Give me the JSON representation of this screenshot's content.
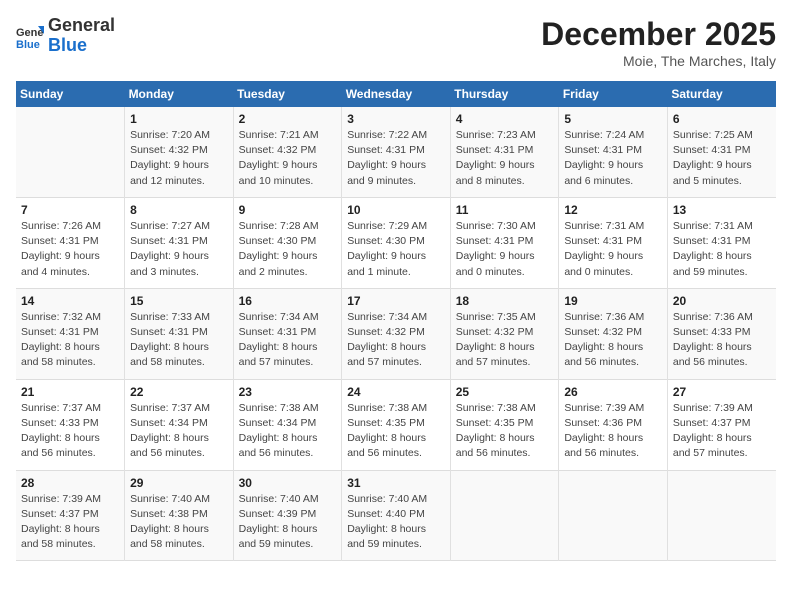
{
  "logo": {
    "general": "General",
    "blue": "Blue"
  },
  "calendar": {
    "title": "December 2025",
    "subtitle": "Moie, The Marches, Italy"
  },
  "days_header": [
    "Sunday",
    "Monday",
    "Tuesday",
    "Wednesday",
    "Thursday",
    "Friday",
    "Saturday"
  ],
  "weeks": [
    [
      {
        "day": "",
        "info": ""
      },
      {
        "day": "1",
        "info": "Sunrise: 7:20 AM\nSunset: 4:32 PM\nDaylight: 9 hours\nand 12 minutes."
      },
      {
        "day": "2",
        "info": "Sunrise: 7:21 AM\nSunset: 4:32 PM\nDaylight: 9 hours\nand 10 minutes."
      },
      {
        "day": "3",
        "info": "Sunrise: 7:22 AM\nSunset: 4:31 PM\nDaylight: 9 hours\nand 9 minutes."
      },
      {
        "day": "4",
        "info": "Sunrise: 7:23 AM\nSunset: 4:31 PM\nDaylight: 9 hours\nand 8 minutes."
      },
      {
        "day": "5",
        "info": "Sunrise: 7:24 AM\nSunset: 4:31 PM\nDaylight: 9 hours\nand 6 minutes."
      },
      {
        "day": "6",
        "info": "Sunrise: 7:25 AM\nSunset: 4:31 PM\nDaylight: 9 hours\nand 5 minutes."
      }
    ],
    [
      {
        "day": "7",
        "info": "Sunrise: 7:26 AM\nSunset: 4:31 PM\nDaylight: 9 hours\nand 4 minutes."
      },
      {
        "day": "8",
        "info": "Sunrise: 7:27 AM\nSunset: 4:31 PM\nDaylight: 9 hours\nand 3 minutes."
      },
      {
        "day": "9",
        "info": "Sunrise: 7:28 AM\nSunset: 4:30 PM\nDaylight: 9 hours\nand 2 minutes."
      },
      {
        "day": "10",
        "info": "Sunrise: 7:29 AM\nSunset: 4:30 PM\nDaylight: 9 hours\nand 1 minute."
      },
      {
        "day": "11",
        "info": "Sunrise: 7:30 AM\nSunset: 4:31 PM\nDaylight: 9 hours\nand 0 minutes."
      },
      {
        "day": "12",
        "info": "Sunrise: 7:31 AM\nSunset: 4:31 PM\nDaylight: 9 hours\nand 0 minutes."
      },
      {
        "day": "13",
        "info": "Sunrise: 7:31 AM\nSunset: 4:31 PM\nDaylight: 8 hours\nand 59 minutes."
      }
    ],
    [
      {
        "day": "14",
        "info": "Sunrise: 7:32 AM\nSunset: 4:31 PM\nDaylight: 8 hours\nand 58 minutes."
      },
      {
        "day": "15",
        "info": "Sunrise: 7:33 AM\nSunset: 4:31 PM\nDaylight: 8 hours\nand 58 minutes."
      },
      {
        "day": "16",
        "info": "Sunrise: 7:34 AM\nSunset: 4:31 PM\nDaylight: 8 hours\nand 57 minutes."
      },
      {
        "day": "17",
        "info": "Sunrise: 7:34 AM\nSunset: 4:32 PM\nDaylight: 8 hours\nand 57 minutes."
      },
      {
        "day": "18",
        "info": "Sunrise: 7:35 AM\nSunset: 4:32 PM\nDaylight: 8 hours\nand 57 minutes."
      },
      {
        "day": "19",
        "info": "Sunrise: 7:36 AM\nSunset: 4:32 PM\nDaylight: 8 hours\nand 56 minutes."
      },
      {
        "day": "20",
        "info": "Sunrise: 7:36 AM\nSunset: 4:33 PM\nDaylight: 8 hours\nand 56 minutes."
      }
    ],
    [
      {
        "day": "21",
        "info": "Sunrise: 7:37 AM\nSunset: 4:33 PM\nDaylight: 8 hours\nand 56 minutes."
      },
      {
        "day": "22",
        "info": "Sunrise: 7:37 AM\nSunset: 4:34 PM\nDaylight: 8 hours\nand 56 minutes."
      },
      {
        "day": "23",
        "info": "Sunrise: 7:38 AM\nSunset: 4:34 PM\nDaylight: 8 hours\nand 56 minutes."
      },
      {
        "day": "24",
        "info": "Sunrise: 7:38 AM\nSunset: 4:35 PM\nDaylight: 8 hours\nand 56 minutes."
      },
      {
        "day": "25",
        "info": "Sunrise: 7:38 AM\nSunset: 4:35 PM\nDaylight: 8 hours\nand 56 minutes."
      },
      {
        "day": "26",
        "info": "Sunrise: 7:39 AM\nSunset: 4:36 PM\nDaylight: 8 hours\nand 56 minutes."
      },
      {
        "day": "27",
        "info": "Sunrise: 7:39 AM\nSunset: 4:37 PM\nDaylight: 8 hours\nand 57 minutes."
      }
    ],
    [
      {
        "day": "28",
        "info": "Sunrise: 7:39 AM\nSunset: 4:37 PM\nDaylight: 8 hours\nand 58 minutes."
      },
      {
        "day": "29",
        "info": "Sunrise: 7:40 AM\nSunset: 4:38 PM\nDaylight: 8 hours\nand 58 minutes."
      },
      {
        "day": "30",
        "info": "Sunrise: 7:40 AM\nSunset: 4:39 PM\nDaylight: 8 hours\nand 59 minutes."
      },
      {
        "day": "31",
        "info": "Sunrise: 7:40 AM\nSunset: 4:40 PM\nDaylight: 8 hours\nand 59 minutes."
      },
      {
        "day": "",
        "info": ""
      },
      {
        "day": "",
        "info": ""
      },
      {
        "day": "",
        "info": ""
      }
    ]
  ]
}
